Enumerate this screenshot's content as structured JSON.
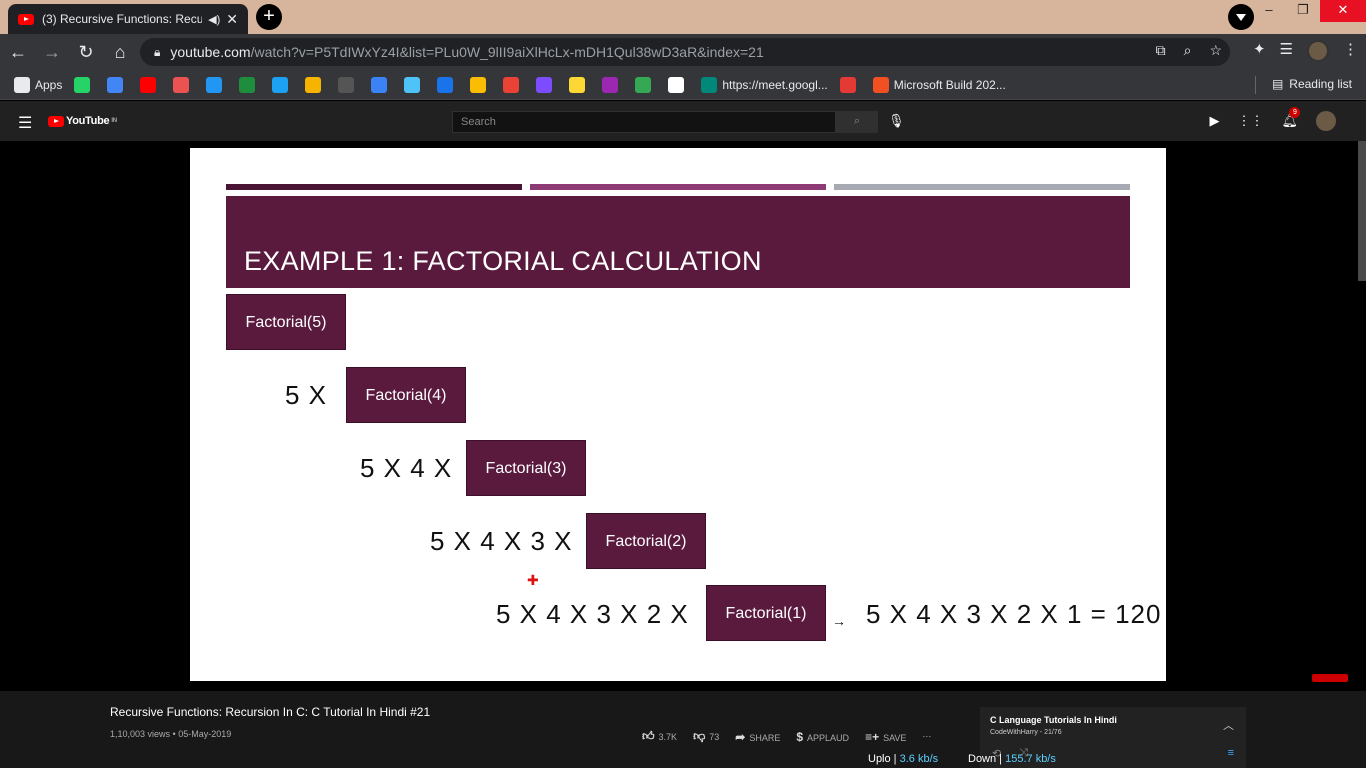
{
  "browser": {
    "tab_title": "(3) Recursive Functions: Recu",
    "url_host": "youtube.com",
    "url_rest": "/watch?v=P5TdIWxYz4I&list=PLu0W_9lII9aiXlHcLx-mDH1Qul38wD3aR&index=21",
    "bookmarks": [
      {
        "label": "Apps",
        "icon": "apps-grid-icon",
        "color": "#e8eaed"
      },
      {
        "label": "",
        "icon": "whatsapp-icon",
        "color": "#25d366"
      },
      {
        "label": "",
        "icon": "bookmark-icon",
        "color": "#4285f4"
      },
      {
        "label": "",
        "icon": "youtube-icon",
        "color": "#ff0000"
      },
      {
        "label": "",
        "icon": "udemy-icon",
        "color": "#ec5252"
      },
      {
        "label": "",
        "icon": "w-icon",
        "color": "#2196f3"
      },
      {
        "label": "",
        "icon": "circle-icon",
        "color": "#1e8e3e"
      },
      {
        "label": "",
        "icon": "bird-icon",
        "color": "#1da1f2"
      },
      {
        "label": "",
        "icon": "photo-icon",
        "color": "#f6b400"
      },
      {
        "label": "",
        "icon": "m-icon",
        "color": "#555555"
      },
      {
        "label": "",
        "icon": "c-icon",
        "color": "#3b82f6"
      },
      {
        "label": "",
        "icon": "n-icon",
        "color": "#4fc3f7"
      },
      {
        "label": "",
        "icon": "bug-icon",
        "color": "#1a73e8"
      },
      {
        "label": "",
        "icon": "doc-icon",
        "color": "#fbbc04"
      },
      {
        "label": "",
        "icon": "box-icon",
        "color": "#ea4335"
      },
      {
        "label": "",
        "icon": "bolt-icon",
        "color": "#7c4dff"
      },
      {
        "label": "",
        "icon": "di-icon",
        "color": "#fdd835"
      },
      {
        "label": "",
        "icon": "m-purple-icon",
        "color": "#9c27b0"
      },
      {
        "label": "",
        "icon": "play-store-icon",
        "color": "#34a853"
      },
      {
        "label": "",
        "icon": "google-icon",
        "color": "#ffffff"
      },
      {
        "label": "https://meet.googl...",
        "icon": "meet-icon",
        "color": "#00897b"
      },
      {
        "label": "",
        "icon": "e-icon",
        "color": "#e53935"
      },
      {
        "label": "Microsoft Build 202...",
        "icon": "microsoft-icon",
        "color": "#f25022"
      }
    ],
    "reading_list": "Reading list"
  },
  "youtube": {
    "logo_text": "YouTube",
    "country": "IN",
    "search_placeholder": "Search",
    "notification_count": "9"
  },
  "slide": {
    "title": "EXAMPLE 1: FACTORIAL CALCULATION",
    "boxes": [
      "Factorial(5)",
      "Factorial(4)",
      "Factorial(3)",
      "Factorial(2)",
      "Factorial(1)"
    ],
    "expressions": [
      "5 X",
      "5 X 4 X",
      "5 X 4 X 3 X",
      "5 X 4 X 3 X 2 X"
    ],
    "result": "5 X 4 X 3 X 2 X 1 = 120",
    "arrow": "→",
    "bar_colors": [
      "#4a1535",
      "#8e3a74",
      "#a7aab2"
    ],
    "accent": "#5a1a3e"
  },
  "video": {
    "title": "Recursive Functions: Recursion In C: C Tutorial In Hindi #21",
    "meta": "1,10,003 views • 05-May-2019",
    "likes": "3.7K",
    "dislikes": "73",
    "share": "SHARE",
    "applaud": "APPLAUD",
    "save": "SAVE"
  },
  "playlist": {
    "title": "C Language Tutorials In Hindi",
    "subtitle": "CodeWithHarry - 21/76"
  },
  "network": {
    "upload_label": "Uplo",
    "upload_value": "3.6 kb/s",
    "download_label": "Down",
    "download_value": "155.7 kb/s"
  }
}
